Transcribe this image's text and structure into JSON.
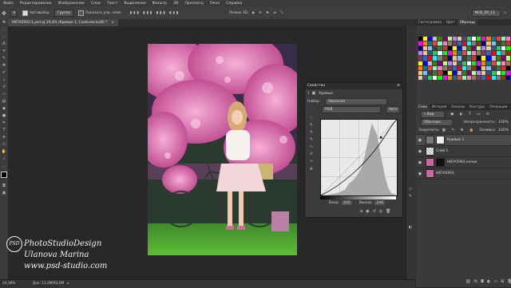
{
  "menu": [
    "Файл",
    "Редактирование",
    "Изображение",
    "Слои",
    "Текст",
    "Выделение",
    "Фильтр",
    "3D",
    "Просмотр",
    "Окно",
    "Справка"
  ],
  "options": {
    "autoselect_label": "Автовыбор:",
    "autoselect_value": "Группа",
    "show_controls_label": "Показать упр. элем.",
    "mode3d_label": "Режим 3D:",
    "workspace_value": "МОЕ_ЯР_11"
  },
  "document": {
    "tab_title": "H87A5993-1.psd @ 24,4% (Кривые 1, Слой-маска/8) *"
  },
  "status": {
    "zoom": "24,38%",
    "doc_size": "Док: 13,0M/93,0M"
  },
  "watermark": {
    "line1": "PhotoStudioDesign",
    "line2": "Ulanova Marina",
    "line3": "www.psd-studio.com",
    "logo_text": "PSD"
  },
  "properties": {
    "title": "Свойства",
    "panel_name": "Кривые",
    "preset_label": "Набор:",
    "preset_value": "Заказная",
    "channel_value": "RGB",
    "auto_button": "Авто",
    "input_label": "Вход:",
    "input_value": "205",
    "output_label": "Выход:",
    "output_value": "246"
  },
  "right_panel": {
    "top_tabs": [
      "Гистограмма",
      "Цвет",
      "Образцы"
    ],
    "layer_tabs": [
      "Слои",
      "История",
      "Каналы",
      "Контуры",
      "Операции"
    ],
    "kind_label": "Вид",
    "blend_mode": "Обычные",
    "opacity_label": "Непрозрачность:",
    "opacity_value": "100%",
    "lock_label": "Закрепить:",
    "fill_label": "Заливка:",
    "fill_value": "100%",
    "layers": [
      {
        "name": "Кривые 1",
        "selected": true
      },
      {
        "name": "Слой 1",
        "selected": false
      },
      {
        "name": "H87A5993 копия",
        "selected": false
      },
      {
        "name": "H87A5993",
        "selected": false
      }
    ]
  },
  "swatch_colors": [
    "#000000",
    "#ffffff",
    "#ff0000",
    "#ffff00",
    "#00ff00",
    "#00ffff",
    "#0000ff",
    "#ff00ff",
    "#7f7f7f",
    "#c0c0c0",
    "#ff7f00",
    "#7f3f00",
    "#3f7f00",
    "#007f7f",
    "#00007f",
    "#7f007f",
    "#ff3f3f",
    "#ffbf7f",
    "#bfff7f",
    "#7fffbf",
    "#7fbfff",
    "#bf7fff",
    "#ff7fbf",
    "#3f3f3f",
    "#e6c8a0",
    "#a07850",
    "#506e3c",
    "#3c5078",
    "#783c64",
    "#c83232",
    "#32c864",
    "#3264c8"
  ],
  "accent": "#4e9af1"
}
